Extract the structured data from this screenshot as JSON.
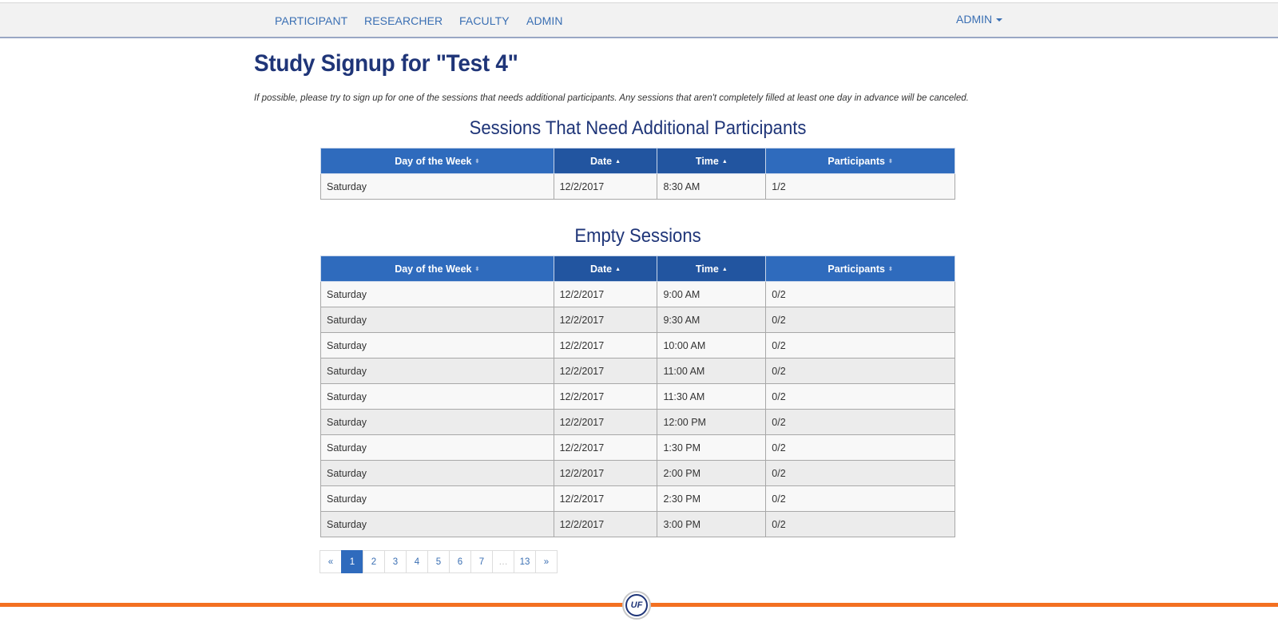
{
  "nav": {
    "links": [
      "PARTICIPANT",
      "RESEARCHER",
      "FACULTY",
      "ADMIN"
    ],
    "user_menu": "ADMIN"
  },
  "page": {
    "title": "Study Signup for \"Test 4\"",
    "intro": "If possible, please try to sign up for one of the sessions that needs additional participants. Any sessions that aren't completely filled at least one day in advance will be canceled."
  },
  "columns": [
    "Day of the Week",
    "Date",
    "Time",
    "Participants"
  ],
  "need_participants": {
    "title": "Sessions That Need Additional Participants",
    "rows": [
      [
        "Saturday",
        "12/2/2017",
        "8:30 AM",
        "1/2"
      ]
    ]
  },
  "empty_sessions": {
    "title": "Empty Sessions",
    "rows": [
      [
        "Saturday",
        "12/2/2017",
        "9:00 AM",
        "0/2"
      ],
      [
        "Saturday",
        "12/2/2017",
        "9:30 AM",
        "0/2"
      ],
      [
        "Saturday",
        "12/2/2017",
        "10:00 AM",
        "0/2"
      ],
      [
        "Saturday",
        "12/2/2017",
        "11:00 AM",
        "0/2"
      ],
      [
        "Saturday",
        "12/2/2017",
        "11:30 AM",
        "0/2"
      ],
      [
        "Saturday",
        "12/2/2017",
        "12:00 PM",
        "0/2"
      ],
      [
        "Saturday",
        "12/2/2017",
        "1:30 PM",
        "0/2"
      ],
      [
        "Saturday",
        "12/2/2017",
        "2:00 PM",
        "0/2"
      ],
      [
        "Saturday",
        "12/2/2017",
        "2:30 PM",
        "0/2"
      ],
      [
        "Saturday",
        "12/2/2017",
        "3:00 PM",
        "0/2"
      ]
    ]
  },
  "pagination": {
    "prev": "«",
    "pages": [
      "1",
      "2",
      "3",
      "4",
      "5",
      "6",
      "7",
      "…",
      "13"
    ],
    "next": "»",
    "active": "1"
  },
  "footer": {
    "logo_text": "UF"
  },
  "colors": {
    "brand_blue": "#1f3578",
    "header_blue": "#2f6bbd",
    "accent_orange": "#f37021"
  }
}
